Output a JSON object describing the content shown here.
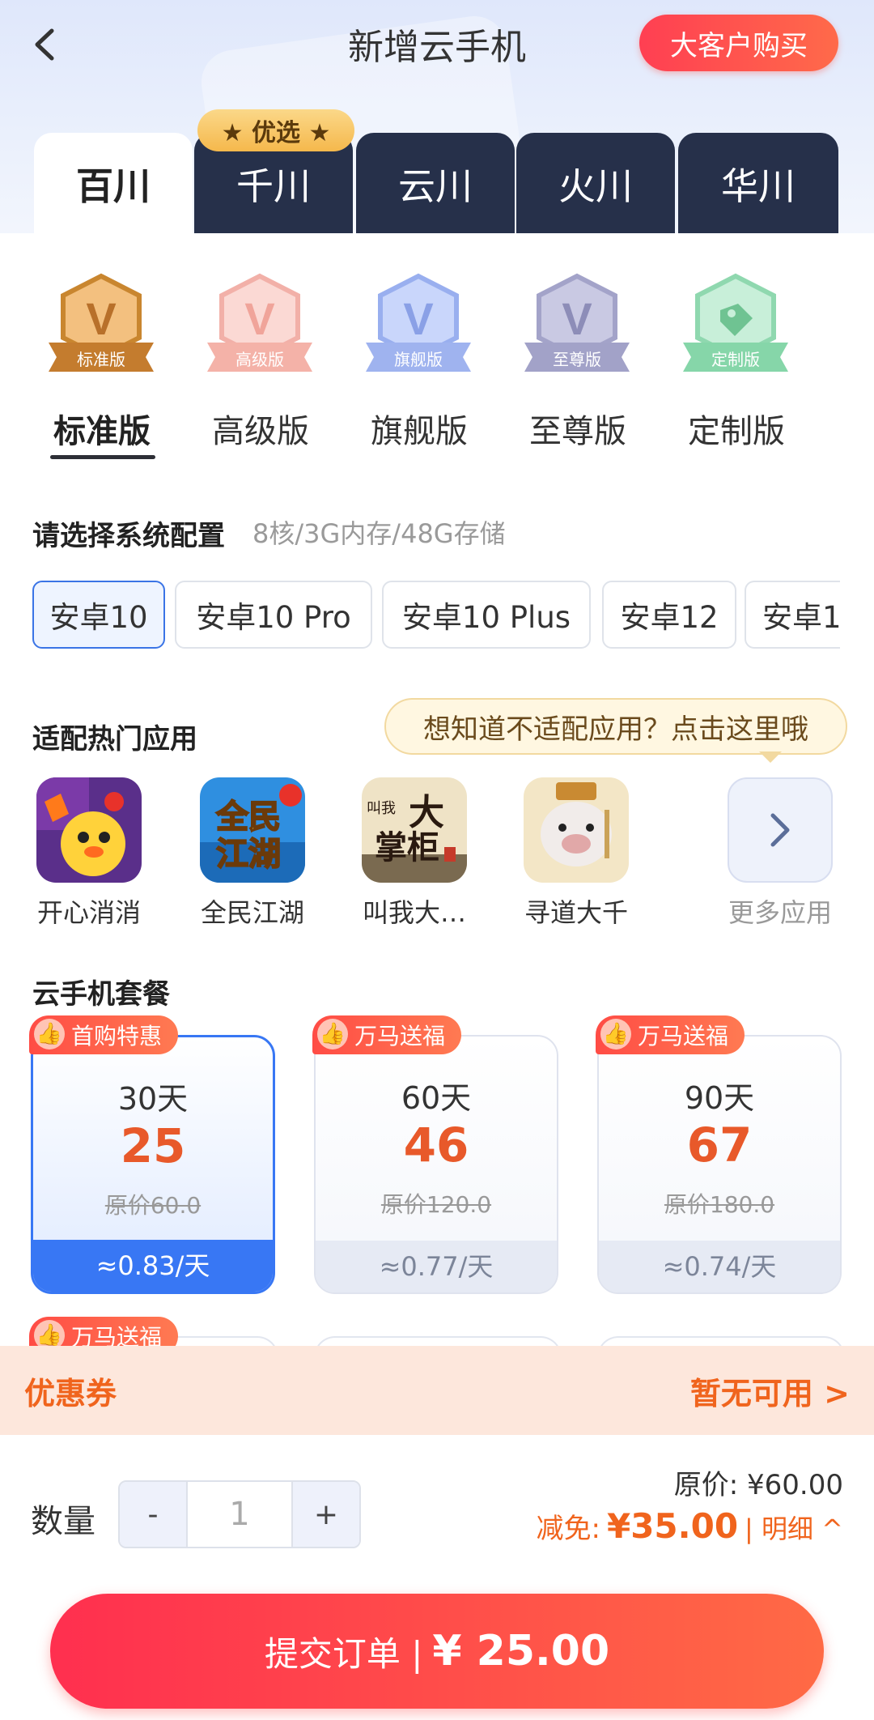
{
  "header": {
    "title": "新增云手机",
    "vip_button": "大客户购买"
  },
  "product_tabs": {
    "badge": "★ 优选 ★",
    "items": [
      "百川",
      "千川",
      "云川",
      "火川",
      "华川"
    ],
    "active": "百川"
  },
  "editions": [
    {
      "name": "标准版",
      "ribbon": "标准版",
      "glyph": "V",
      "color": "#d18b3b"
    },
    {
      "name": "高级版",
      "ribbon": "高级版",
      "glyph": "V",
      "color": "#f2a7a0"
    },
    {
      "name": "旗舰版",
      "ribbon": "旗舰版",
      "glyph": "V",
      "color": "#8fa7ee"
    },
    {
      "name": "至尊版",
      "ribbon": "至尊版",
      "glyph": "V",
      "color": "#9c9cc4"
    },
    {
      "name": "定制版",
      "ribbon": "定制版",
      "glyph": "tag-icon",
      "color": "#7fd3a6"
    }
  ],
  "system_config": {
    "title": "请选择系统配置",
    "spec": "8核/3G内存/48G存储",
    "options": [
      "安卓10",
      "安卓10 Pro",
      "安卓10 Plus",
      "安卓12",
      "安卓1"
    ],
    "selected": "安卓10"
  },
  "apps": {
    "title": "适配热门应用",
    "tip": "想知道不适配应用？点击这里哦",
    "items": [
      {
        "name": "开心消消",
        "icon": "game-icon-chick"
      },
      {
        "name": "全民江湖",
        "icon": "game-icon-jianghu"
      },
      {
        "name": "叫我大…",
        "icon": "game-icon-zhanggui"
      },
      {
        "name": "寻道大千",
        "icon": "game-icon-pig"
      }
    ],
    "more": "更多应用"
  },
  "packages": {
    "title": "云手机套餐",
    "items": [
      {
        "tag": "首购特惠",
        "days": "30天",
        "price": "25",
        "original": "原价60.0",
        "per_day": "≈0.83/天",
        "selected": true
      },
      {
        "tag": "万马送福",
        "days": "60天",
        "price": "46",
        "original": "原价120.0",
        "per_day": "≈0.77/天",
        "selected": false
      },
      {
        "tag": "万马送福",
        "days": "90天",
        "price": "67",
        "original": "原价180.0",
        "per_day": "≈0.74/天",
        "selected": false
      }
    ],
    "next_row_tag": "万马送福"
  },
  "coupon": {
    "label": "优惠券",
    "status": "暂无可用 >"
  },
  "order": {
    "qty_label": "数量",
    "minus": "-",
    "qty": "1",
    "plus": "+",
    "original_price": "原价: ¥60.00",
    "discount_label": "减免:",
    "discount_amount": "¥35.00",
    "detail": "| 明细 ^",
    "submit_label": "提交订单 |",
    "submit_amount": "¥ 25.00"
  },
  "colors": {
    "accent_blue": "#3877f4",
    "accent_red": "#ff3f52",
    "price_orange": "#e8592a",
    "tab_dark": "#26304a"
  }
}
